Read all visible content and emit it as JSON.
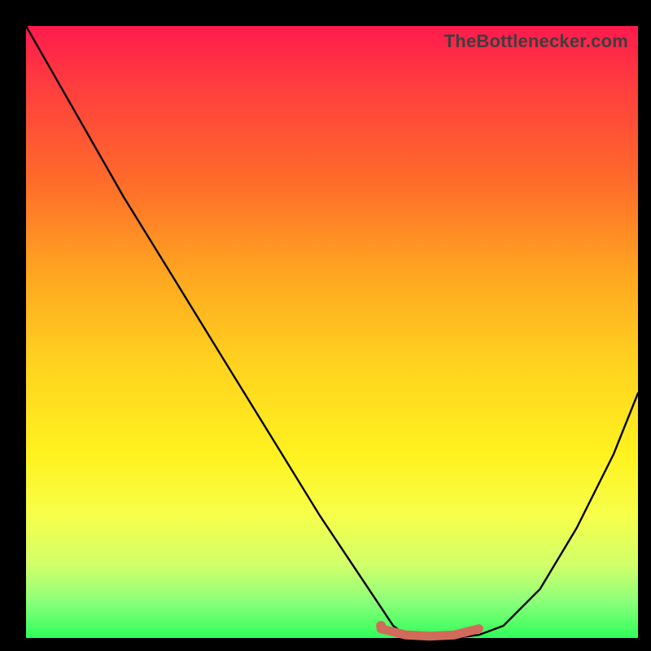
{
  "attribution": "TheBottlenecker.com",
  "colors": {
    "frame_bg": "#000000",
    "grad_top": "#ff1a4d",
    "grad_mid": "#ffd21f",
    "grad_bot": "#2fff5a",
    "curve": "#000000",
    "highlight": "#d26a5c"
  },
  "chart_data": {
    "type": "line",
    "title": "",
    "xlabel": "",
    "ylabel": "",
    "xlim": [
      0,
      100
    ],
    "ylim": [
      0,
      100
    ],
    "series": [
      {
        "name": "curve-black",
        "x": [
          0,
          8,
          16,
          24,
          32,
          40,
          48,
          54,
          58,
          60,
          62,
          66,
          70,
          74,
          78,
          84,
          90,
          96,
          100
        ],
        "y": [
          100,
          86,
          72,
          59,
          46,
          33,
          20,
          11,
          5,
          2,
          0.5,
          0,
          0,
          0.5,
          2,
          8,
          18,
          30,
          40
        ]
      },
      {
        "name": "highlight-segment",
        "x": [
          58,
          62,
          66,
          70,
          74
        ],
        "y": [
          1.5,
          0.5,
          0.3,
          0.5,
          1.5
        ]
      }
    ],
    "highlight_dot": {
      "x": 58,
      "y": 2
    }
  }
}
